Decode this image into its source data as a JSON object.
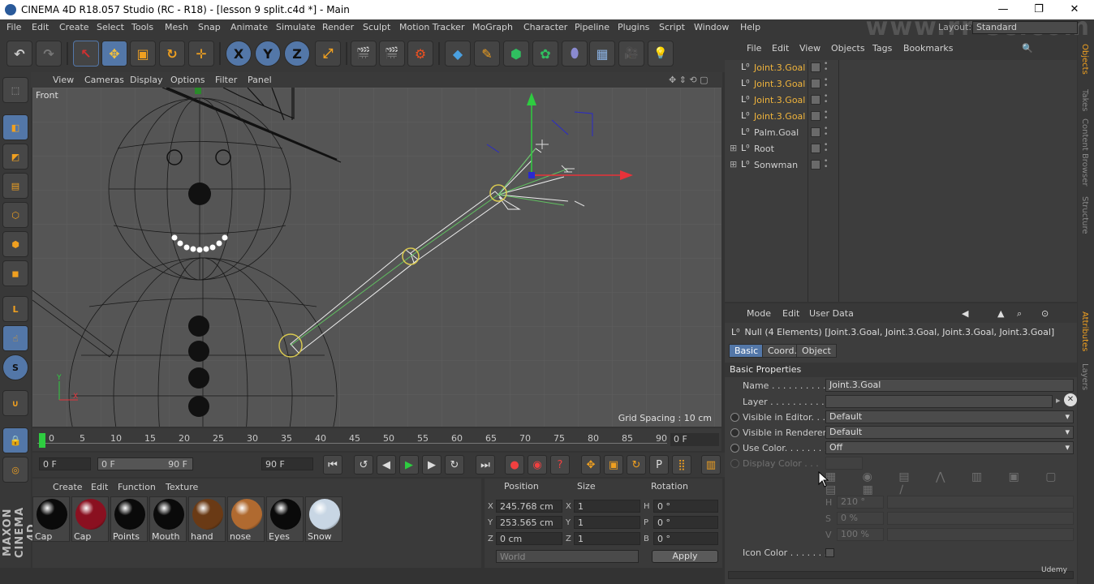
{
  "window": {
    "title": "CINEMA 4D R18.057 Studio (RC - R18) - [lesson 9 split.c4d *] - Main",
    "minimize": "—",
    "maximize": "❐",
    "close": "✕"
  },
  "menu": [
    "File",
    "Edit",
    "Create",
    "Select",
    "Tools",
    "Mesh",
    "Snap",
    "Animate",
    "Simulate",
    "Render",
    "Sculpt",
    "Motion Tracker",
    "MoGraph",
    "Character",
    "Pipeline",
    "Plugins",
    "Script",
    "Window",
    "Help"
  ],
  "watermark": "www.rr-sc.com",
  "layout": {
    "label": "Layout:",
    "value": "Standard"
  },
  "toolbar": {
    "undo": "↶",
    "redo": "↷",
    "select": "↖",
    "move": "✥",
    "scale": "▣",
    "rotate": "↻",
    "transform": "✛",
    "axis_x": "X",
    "axis_y": "Y",
    "axis_z": "Z",
    "coords": "⤢",
    "render_view": "🎬",
    "render_pic": "🎬",
    "render_settings": "⚙",
    "cube": "◆",
    "pen": "✎",
    "subdiv": "⬢",
    "cloner": "✿",
    "deformer": "⬮",
    "floor": "▦",
    "camera": "🎥",
    "light": "💡"
  },
  "left_tools": {
    "make_editable": "⬚",
    "model": "◧",
    "texture": "◩",
    "workplane": "▤",
    "points": "⬡",
    "edges": "⬢",
    "polygons": "◼",
    "axis": "L",
    "tweak": "☝",
    "snap": "S",
    "magnet": "∪",
    "lock": "🔒",
    "soft": "◎"
  },
  "maxon": "MAXON CINEMA 4D",
  "viewport": {
    "menu": [
      "View",
      "Cameras",
      "Display",
      "Options",
      "Filter",
      "Panel"
    ],
    "name": "Front",
    "grid_spacing": "Grid Spacing : 10 cm",
    "nav_icons": "✥ ⇕ ⟲ ▢"
  },
  "timeline": {
    "ticks": [
      "0",
      "5",
      "10",
      "15",
      "20",
      "25",
      "30",
      "35",
      "40",
      "45",
      "50",
      "55",
      "60",
      "65",
      "70",
      "75",
      "80",
      "85",
      "90"
    ],
    "current_frame": "0 F"
  },
  "transport": {
    "start": "0 F",
    "range_start": "0 F",
    "range_end": "90 F",
    "end": "90 F",
    "first": "⏮",
    "prev_key": "↺",
    "prev": "◀",
    "play": "▶",
    "next": "▶",
    "next_key": "↻",
    "last": "⏭",
    "record": "●",
    "auto_key": "◉",
    "key_help": "?",
    "key_move": "✥",
    "key_scale": "▣",
    "key_rot": "↻",
    "key_param": "P",
    "key_pla": "⣿",
    "timeline_btn": "▥"
  },
  "materials": {
    "menu": [
      "Create",
      "Edit",
      "Function",
      "Texture"
    ],
    "items": [
      {
        "name": "Cap",
        "color": "#0a0a0a"
      },
      {
        "name": "Cap",
        "color": "#8a1020"
      },
      {
        "name": "Points",
        "color": "#0a0a0a"
      },
      {
        "name": "Mouth",
        "color": "#0a0a0a"
      },
      {
        "name": "hand",
        "color": "#6a3a15"
      },
      {
        "name": "nose",
        "color": "#b06a30"
      },
      {
        "name": "Eyes",
        "color": "#0a0a0a"
      },
      {
        "name": "Snow",
        "color": "#c8d6e4"
      }
    ]
  },
  "coords": {
    "headers": {
      "position": "Position",
      "size": "Size",
      "rotation": "Rotation"
    },
    "x": {
      "label": "X",
      "pos": "245.768 cm",
      "size_label": "X",
      "size": "1",
      "rot_label": "H",
      "rot": "0 °"
    },
    "y": {
      "label": "Y",
      "pos": "253.565 cm",
      "size_label": "Y",
      "size": "1",
      "rot_label": "P",
      "rot": "0 °"
    },
    "z": {
      "label": "Z",
      "pos": "0 cm",
      "size_label": "Z",
      "size": "1",
      "rot_label": "B",
      "rot": "0 °"
    },
    "space": "World",
    "apply": "Apply"
  },
  "objects": {
    "menu": [
      "File",
      "Edit",
      "View",
      "Objects",
      "Tags",
      "Bookmarks"
    ],
    "rows": [
      {
        "name": "Joint.3.Goal",
        "selected": true
      },
      {
        "name": "Joint.3.Goal",
        "selected": true
      },
      {
        "name": "Joint.3.Goal",
        "selected": true
      },
      {
        "name": "Joint.3.Goal",
        "selected": true
      },
      {
        "name": "Palm.Goal",
        "selected": false
      },
      {
        "name": "Root",
        "selected": false,
        "expandable": true
      },
      {
        "name": "Sonwman",
        "selected": false,
        "expandable": true
      }
    ]
  },
  "right_tabs": [
    "Objects",
    "Takes",
    "Content Browser",
    "Structure",
    "Attributes",
    "Layers"
  ],
  "attributes": {
    "menu": [
      "Mode",
      "Edit",
      "User Data"
    ],
    "title": "Null (4 Elements) [Joint.3.Goal, Joint.3.Goal, Joint.3.Goal, Joint.3.Goal]",
    "tabs": [
      "Basic",
      "Coord.",
      "Object"
    ],
    "section": "Basic Properties",
    "name_label": "Name . . . . . . . . . . . . .",
    "name_value": "Joint.3.Goal",
    "layer_label": "Layer . . . . . . . . . . . . .",
    "vis_editor_label": "Visible in Editor. . .",
    "vis_editor_value": "Default",
    "vis_render_label": "Visible in Renderer",
    "vis_render_value": "Default",
    "use_color_label": "Use Color. . . . . . . .",
    "use_color_value": "Off",
    "display_color_label": "Display Color . . .",
    "h_label": "H",
    "h_value": "210 °",
    "s_label": "S",
    "s_value": "0 %",
    "v_label": "V",
    "v_value": "100 %",
    "icon_color_label": "Icon Color . . . . . . .",
    "udemy": "Udemy"
  },
  "colors": {
    "accent": "#5377a8",
    "selected_text": "#f0b43c",
    "bg": "#383838"
  }
}
